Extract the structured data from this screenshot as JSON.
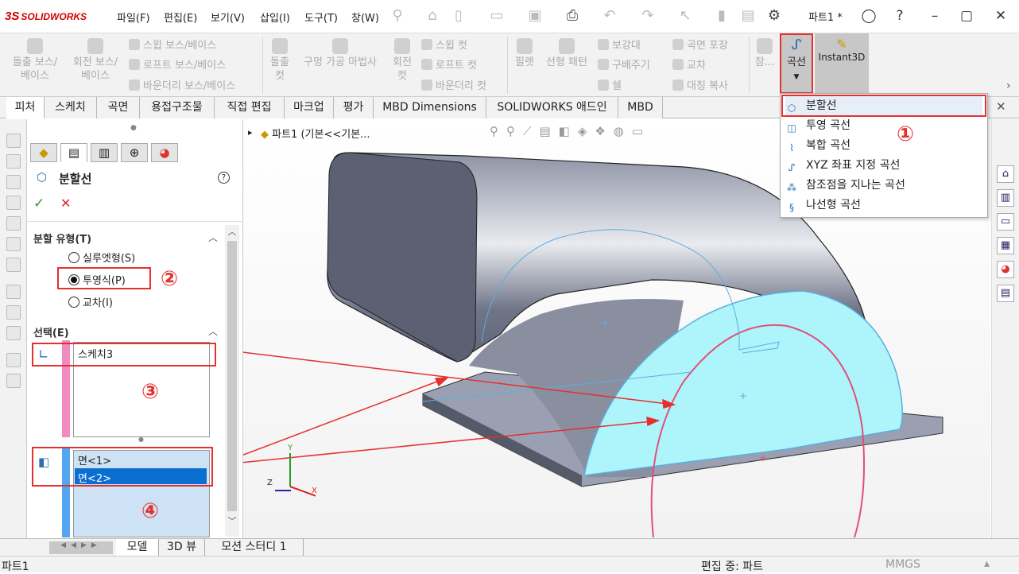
{
  "app": {
    "logo_text": "SOLIDWORKS",
    "logo_mark": "3S",
    "doc_title": "파트1 *"
  },
  "menu": [
    "파일(F)",
    "편집(E)",
    "보기(V)",
    "삽입(I)",
    "도구(T)",
    "창(W)"
  ],
  "ribbon": {
    "extrude_boss": "돌출 보스/\n베이스",
    "revolve_boss": "회전 보스/\n베이스",
    "sweep_boss": "스윕 보스/베이스",
    "loft_boss": "로프트 보스/베이스",
    "boundary_boss": "바운더리 보스/베이스",
    "extrude_cut": "돌출\n컷",
    "hole_wizard": "구멍 가공 마법사",
    "revolve_cut": "회전\n컷",
    "sweep_cut": "스윕 컷",
    "loft_cut": "로프트 컷",
    "boundary_cut": "바운더리 컷",
    "fillet": "필렛",
    "linear_pattern": "선형 패턴",
    "rib": "보강대",
    "draft": "구배주기",
    "shell": "쉘",
    "wrap": "곡면 포장",
    "intersect": "교차",
    "mirror": "대칭 복사",
    "ref_geom": "참...",
    "curves": "곡선",
    "instant3d": "Instant3D"
  },
  "tabs": [
    "피처",
    "스케치",
    "곡면",
    "용접구조물",
    "직접 편집",
    "마크업",
    "평가",
    "MBD Dimensions",
    "SOLIDWORKS 애드인",
    "MBD"
  ],
  "tree_header": "파트1  (기본<<기본...",
  "panel": {
    "title": "분할선",
    "split_type_title": "분할 유형(T)",
    "option_silhouette": "실루엣형(S)",
    "option_projection": "투영식(P)",
    "option_intersection": "교차(I)",
    "selection_title": "선택(E)",
    "sketch_item": "스케치3",
    "faces": [
      "면<1>",
      "면<2>"
    ]
  },
  "dropdown": [
    {
      "label": "분할선",
      "icon": "split-line-icon"
    },
    {
      "label": "투영 곡선",
      "icon": "projected-curve-icon"
    },
    {
      "label": "복합 곡선",
      "icon": "composite-curve-icon"
    },
    {
      "label": "XYZ 좌표 지정 곡선",
      "icon": "xyz-curve-icon"
    },
    {
      "label": "참조점을 지나는 곡선",
      "icon": "curve-through-points-icon"
    },
    {
      "label": "나선형 곡선",
      "icon": "helix-icon"
    }
  ],
  "annotations": [
    "①",
    "②",
    "③",
    "④"
  ],
  "axes": {
    "x": "X",
    "y": "Y",
    "z": "Z"
  },
  "bottom_tabs": [
    "모델",
    "3D 뷰",
    "모션 스터디 1"
  ],
  "status": {
    "left": "파트1",
    "center": "편집 중: 파트",
    "units": "MMGS"
  },
  "colors": {
    "accent_red": "#e53030",
    "face_cyan": "#aef4fb",
    "sketch_pink": "#e0507a",
    "select_blue": "#0a6fd1"
  }
}
